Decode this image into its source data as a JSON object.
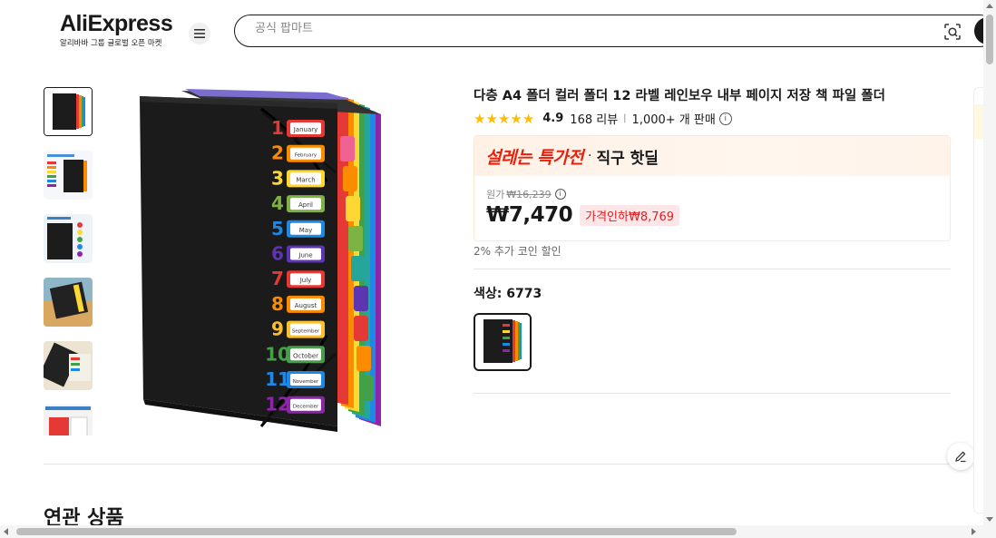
{
  "header": {
    "logo": "AliExpress",
    "logo_sub": "알리바바 그룹 글로벌 오픈 마켓",
    "menu_icon": "hamburger-icon",
    "search_placeholder": "공식 팝마트",
    "search_icons": [
      "image-search-icon"
    ]
  },
  "product": {
    "title": "다층 A4 폴더 컬러 폴더 12 라벨 레인보우 내부 페이지 저장 책 파일 폴더",
    "rating": "4.9",
    "reviews": "168 리뷰",
    "sold": "1,000+ 개 판매",
    "deal_name": "설레는 특가전",
    "deal_sep": "·",
    "deal_sub": "직구 핫딜",
    "original_label": "원가",
    "original_price": "₩16,239",
    "price": "₩7,470",
    "discount": "가격인하₩8,769",
    "coin": "2% 추가 코인 할인",
    "color_label": "색상: 6773",
    "months": [
      "January",
      "February",
      "March",
      "April",
      "May",
      "June",
      "July",
      "August",
      "September",
      "October",
      "November",
      "December"
    ],
    "numbers": [
      "1",
      "2",
      "3",
      "4",
      "5",
      "6",
      "7",
      "8",
      "9",
      "10",
      "11",
      "12"
    ],
    "tab_colors": [
      "#e53935",
      "#fb8c00",
      "#fdd835",
      "#7cb342",
      "#1e88e5",
      "#5e35b1",
      "#e53935",
      "#fb8c00",
      "#fbc02d",
      "#43a047",
      "#1e88e5",
      "#8e24aa"
    ]
  },
  "related": {
    "title": "연관 상품"
  },
  "thumbnails": [
    "thumb-1",
    "thumb-2",
    "thumb-3",
    "thumb-4",
    "thumb-5",
    "thumb-6"
  ]
}
